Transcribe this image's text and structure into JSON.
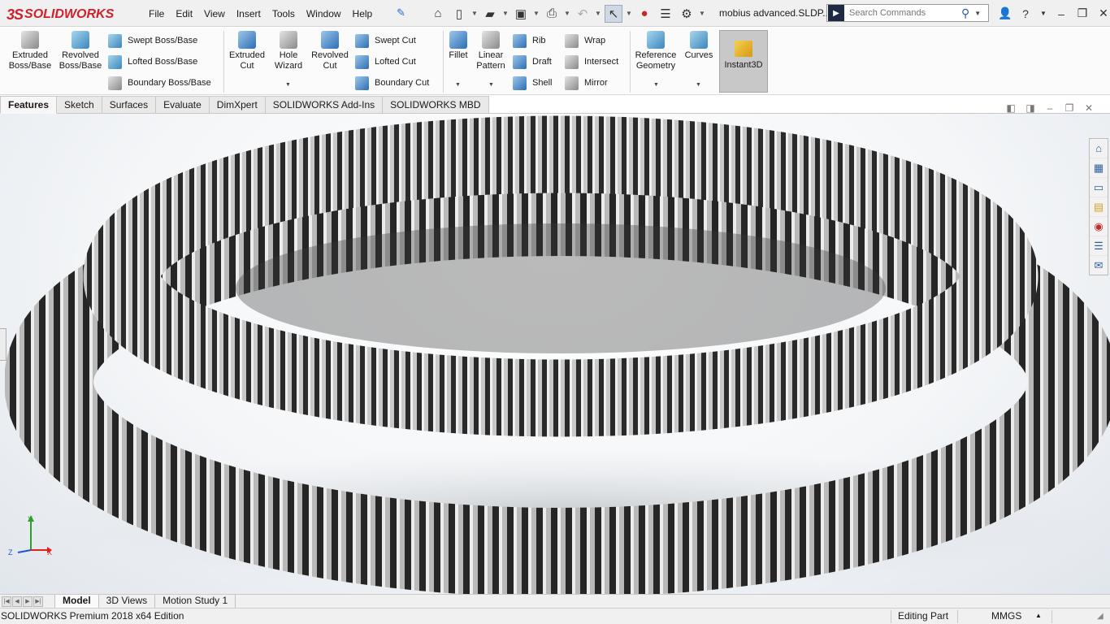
{
  "app": {
    "logo_mark": "3S",
    "logo_text": "SOLIDWORKS",
    "document_title": "mobius advanced.SLDP..."
  },
  "menu": [
    "File",
    "Edit",
    "View",
    "Insert",
    "Tools",
    "Window",
    "Help"
  ],
  "search": {
    "placeholder": "Search Commands"
  },
  "ribbon": {
    "extruded_boss": "Extruded Boss/Base",
    "revolved_boss": "Revolved Boss/Base",
    "swept_boss": "Swept Boss/Base",
    "lofted_boss": "Lofted Boss/Base",
    "boundary_boss": "Boundary Boss/Base",
    "extruded_cut": "Extruded Cut",
    "hole_wizard": "Hole Wizard",
    "revolved_cut": "Revolved Cut",
    "swept_cut": "Swept Cut",
    "lofted_cut": "Lofted Cut",
    "boundary_cut": "Boundary Cut",
    "fillet": "Fillet",
    "linear_pattern": "Linear Pattern",
    "rib": "Rib",
    "draft": "Draft",
    "shell": "Shell",
    "wrap": "Wrap",
    "intersect": "Intersect",
    "mirror": "Mirror",
    "reference_geometry": "Reference Geometry",
    "curves": "Curves",
    "instant3d": "Instant3D"
  },
  "tabs": [
    "Features",
    "Sketch",
    "Surfaces",
    "Evaluate",
    "DimXpert",
    "SOLIDWORKS Add-Ins",
    "SOLIDWORKS MBD"
  ],
  "triad": {
    "x": "X",
    "y": "Y",
    "z": "Z"
  },
  "bottom_tabs": [
    "Model",
    "3D Views",
    "Motion Study 1"
  ],
  "status": {
    "edition": "SOLIDWORKS Premium 2018 x64 Edition",
    "mode": "Editing Part",
    "units": "MMGS"
  },
  "colors": {
    "brand": "#d0202a",
    "accent": "#2d6eb4"
  }
}
